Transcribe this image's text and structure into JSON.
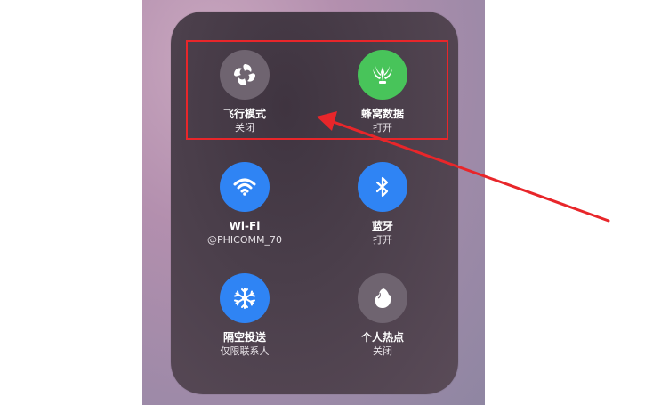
{
  "tiles": [
    {
      "label": "飞行模式",
      "status": "关闭",
      "icon": "airplane-mode-swirl-icon",
      "state": "off"
    },
    {
      "label": "蜂窝数据",
      "status": "打开",
      "icon": "cellular-data-icon",
      "state": "on",
      "color": "#48c45a"
    },
    {
      "label": "Wi-Fi",
      "status": "@PHICOMM_70",
      "icon": "wifi-icon",
      "state": "on",
      "color": "#2f84f4"
    },
    {
      "label": "蓝牙",
      "status": "打开",
      "icon": "bluetooth-icon",
      "state": "on",
      "color": "#2f84f4"
    },
    {
      "label": "隔空投送",
      "status": "仅限联系人",
      "icon": "airdrop-icon",
      "state": "on",
      "color": "#2f84f4"
    },
    {
      "label": "个人热点",
      "status": "关闭",
      "icon": "personal-hotspot-icon",
      "state": "off"
    }
  ],
  "annotation": {
    "highlight_color": "#e8262a"
  }
}
